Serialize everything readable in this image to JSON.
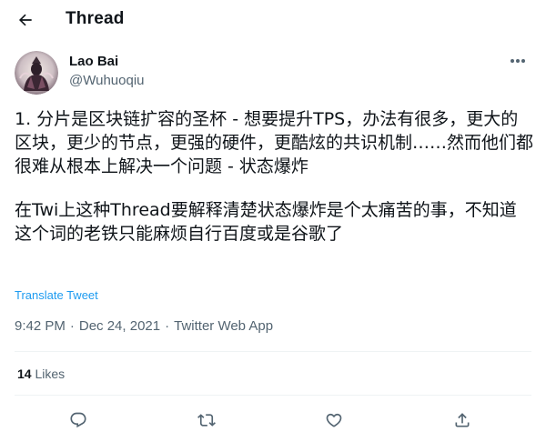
{
  "header": {
    "title": "Thread",
    "back_icon": "arrow-left-icon"
  },
  "author": {
    "name": "Lao Bai",
    "handle": "@Wuhuoqiu",
    "avatar_icon": "user-avatar"
  },
  "tweet": {
    "paragraphs": [
      "1. 分片是区块链扩容的圣杯 - 想要提升TPS，办法有很多，更大的区块，更少的节点，更强的硬件，更酷炫的共识机制……然而他们都很难从根本上解决一个问题 - 状态爆炸",
      "在Twi上这种Thread要解释清楚状态爆炸是个太痛苦的事，不知道这个词的老铁只能麻烦自行百度或是谷歌了"
    ],
    "translate_label": "Translate Tweet",
    "time": "9:42 PM",
    "separator": "·",
    "date": "Dec 24, 2021",
    "source": "Twitter Web App"
  },
  "stats": {
    "likes_count": "14",
    "likes_label": "Likes"
  },
  "actions": {
    "reply_icon": "reply-icon",
    "retweet_icon": "retweet-icon",
    "like_icon": "heart-icon",
    "share_icon": "share-icon"
  },
  "colors": {
    "text": "#0f1419",
    "secondary": "#536471",
    "link": "#1d9bf0",
    "divider": "#eff3f4"
  }
}
